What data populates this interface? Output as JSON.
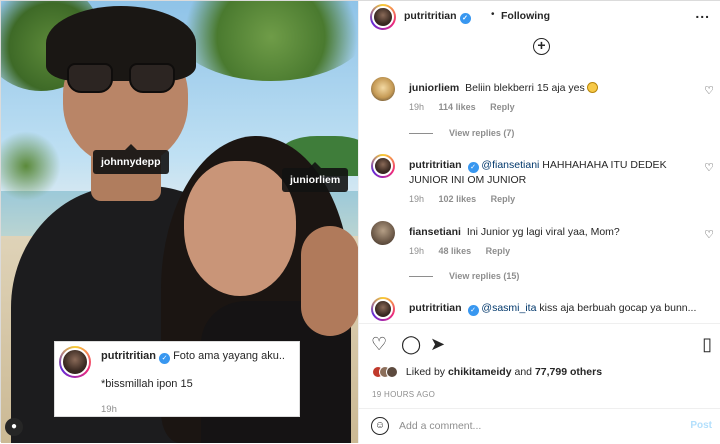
{
  "photo": {
    "tags": {
      "johnny": "johnnydepp",
      "junior": "juniorliem"
    },
    "caption": {
      "username": "putritritian",
      "text": "Foto ama yayang aku..",
      "line2": "*bissmillah ipon 15",
      "time": "19h"
    }
  },
  "header": {
    "username": "putritritian",
    "separator": "•",
    "follow_label": "Following",
    "more_label": "..."
  },
  "load_more_label": "+",
  "comments": [
    {
      "username": "juniorliem",
      "mention": "",
      "text": "Beliin blekberri 15 aja yes",
      "time": "19h",
      "likes": "114 likes",
      "reply": "Reply",
      "view_replies": "View replies (7)"
    },
    {
      "username": "putritritian",
      "mention": "@fiansetiani",
      "text": "HAHHAHAHA ITU DEDEK JUNIOR INI OM JUNIOR",
      "time": "19h",
      "likes": "102 likes",
      "reply": "Reply",
      "view_replies": ""
    },
    {
      "username": "fiansetiani",
      "mention": "",
      "text": "Ini Junior yg lagi viral yaa, Mom?",
      "time": "19h",
      "likes": "48 likes",
      "reply": "Reply",
      "view_replies": "View replies (15)"
    },
    {
      "username": "putritritian",
      "mention": "@sasmi_ita",
      "text": "kiss aja berbuah gocap ya bunn...",
      "time": "",
      "likes": "",
      "reply": "",
      "view_replies": ""
    }
  ],
  "icons": {
    "like": "heart-icon",
    "comment": "comment-icon",
    "share": "share-icon",
    "save": "bookmark-icon"
  },
  "likes": {
    "prefix": "Liked by",
    "user": "chikitameidy",
    "and": "and",
    "others": "77,799 others"
  },
  "post_time": "19 HOURS AGO",
  "add_comment": {
    "placeholder": "Add a comment...",
    "post_label": "Post"
  }
}
